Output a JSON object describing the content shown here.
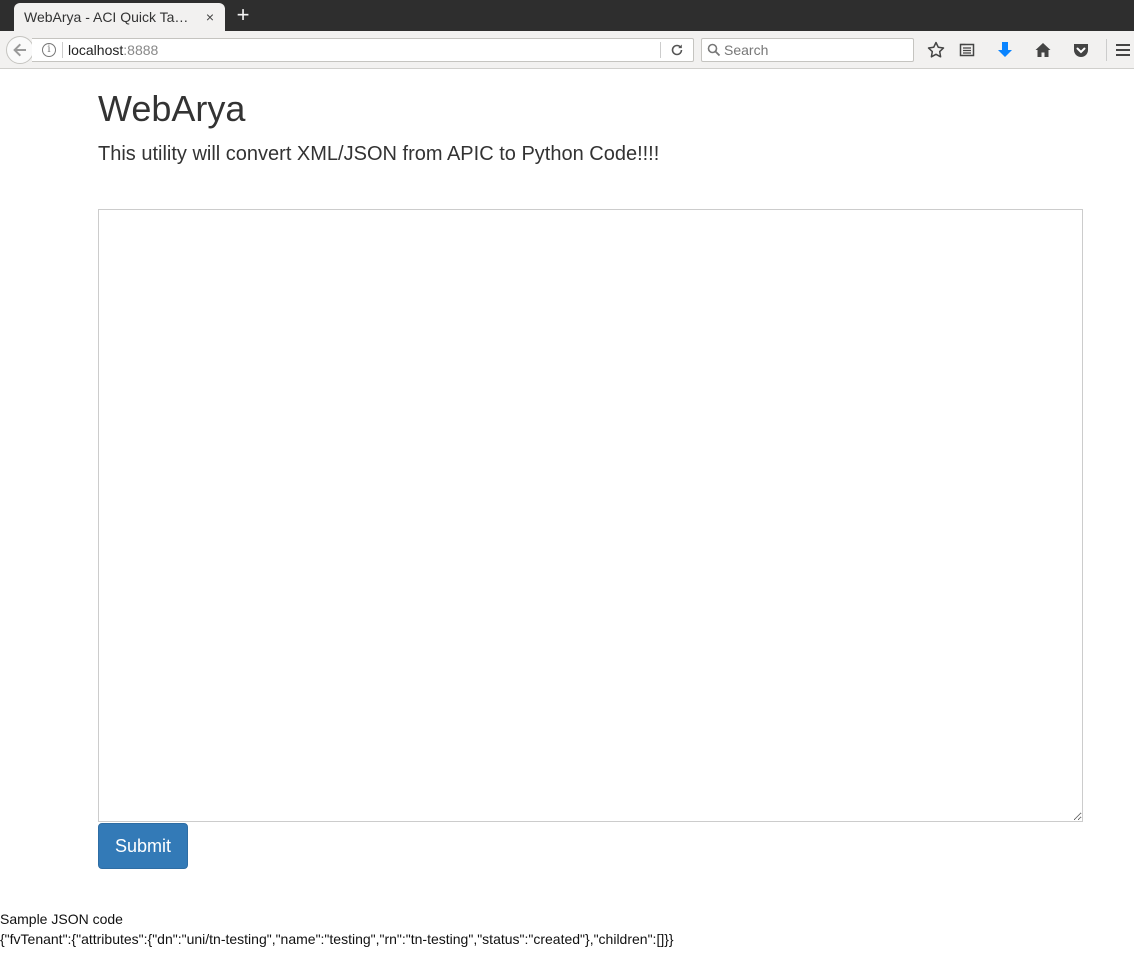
{
  "browser": {
    "tab_title": "WebArya - ACI Quick Ta…",
    "tab_close": "×",
    "new_tab": "+",
    "url_host": "localhost",
    "url_port": ":8888",
    "search_placeholder": "Search",
    "icons": [
      "back-arrow-icon",
      "info-icon",
      "reload-icon",
      "search-icon",
      "bookmark-star-icon",
      "reading-list-icon",
      "download-arrow-icon",
      "home-icon",
      "pocket-icon",
      "hamburger-menu-icon"
    ],
    "download_color": "#0a84ff"
  },
  "page": {
    "title": "WebArya",
    "subtitle": "This utility will convert XML/JSON from APIC to Python Code!!!!",
    "textarea_value": "",
    "submit_label": "Submit",
    "submit_color": "#337ab7",
    "sample_label": "Sample JSON code",
    "sample_code": "{\"fvTenant\":{\"attributes\":{\"dn\":\"uni/tn-testing\",\"name\":\"testing\",\"rn\":\"tn-testing\",\"status\":\"created\"},\"children\":[]}}"
  }
}
